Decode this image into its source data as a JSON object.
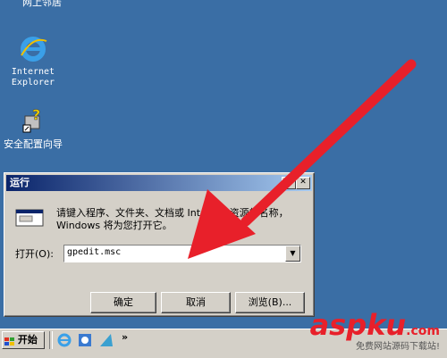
{
  "desktop": {
    "top_label": "网上邻居",
    "icons": [
      {
        "label_line1": "Internet",
        "label_line2": "Explorer"
      },
      {
        "label_line1": "安全配置向导",
        "label_line2": ""
      }
    ]
  },
  "run_dialog": {
    "title": "运行",
    "help_btn": "?",
    "close_btn": "✕",
    "description": "请键入程序、文件夹、文档或 Internet 资源的名称，Windows 将为您打开它。",
    "open_label": "打开(O):",
    "open_value": "gpedit.msc",
    "ok_label": "确定",
    "cancel_label": "取消",
    "browse_label": "浏览(B)..."
  },
  "taskbar": {
    "start_label": "开始",
    "more_label": "»"
  },
  "watermark": {
    "brand": "aspku",
    "suffix": ".com",
    "tagline": "免费网站源码下载站!"
  },
  "colors": {
    "desktop": "#3a6ea5",
    "arrow": "#e8202a",
    "titlebar": "#0a246a"
  }
}
